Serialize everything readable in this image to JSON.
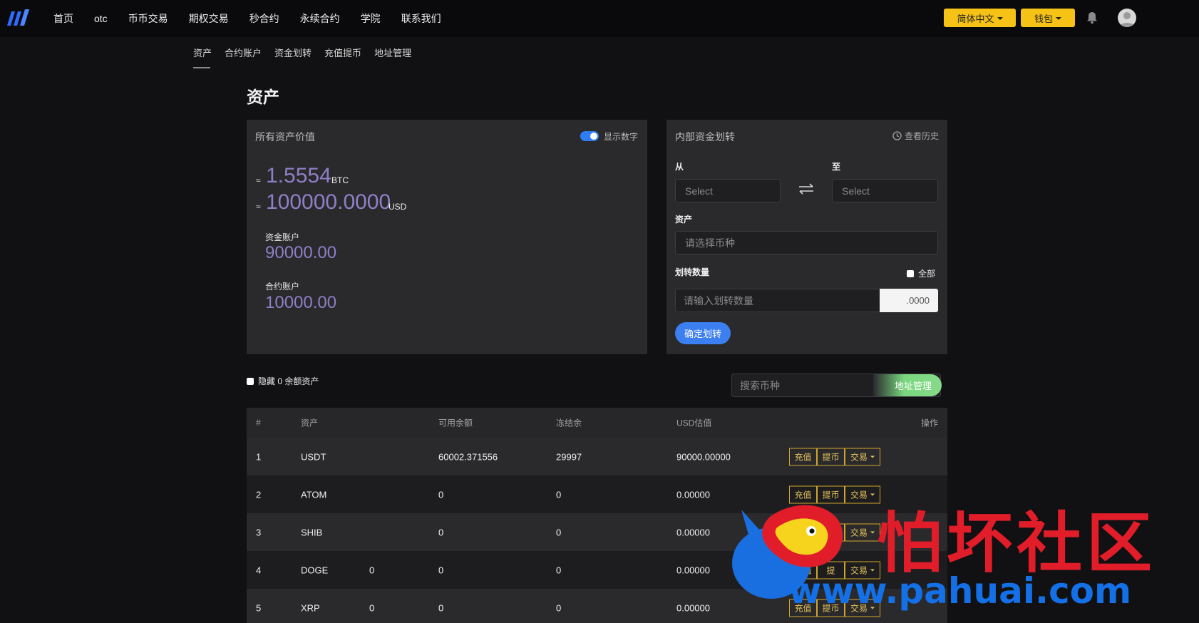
{
  "nav": {
    "items": [
      "首页",
      "otc",
      "币币交易",
      "期权交易",
      "秒合约",
      "永续合约",
      "学院",
      "联系我们"
    ],
    "language": "简体中文",
    "wallet": "钱包"
  },
  "subtabs": [
    "资产",
    "合约账户",
    "资金划转",
    "充值提币",
    "地址管理"
  ],
  "page_title": "资产",
  "assets_card": {
    "title": "所有资产价值",
    "toggle_label": "显示数字",
    "approx": "≈",
    "btc_value": "1.5554",
    "btc_unit": "BTC",
    "usd_value": "100000.0000",
    "usd_unit": "USD",
    "fund_label": "资金账户",
    "fund_value": "90000.00",
    "contract_label": "合约账户",
    "contract_value": "10000.00"
  },
  "transfer_card": {
    "title": "内部资金划转",
    "history": "查看历史",
    "from_label": "从",
    "to_label": "至",
    "from_placeholder": "Select",
    "to_placeholder": "Select",
    "asset_label": "资产",
    "asset_placeholder": "请选择币种",
    "amount_label": "划转数量",
    "all_label": "全部",
    "amount_placeholder": "请输入划转数量",
    "amount_suffix": ".0000",
    "confirm": "确定划转"
  },
  "filter": {
    "hide_zero": "隐藏 0 余额资产",
    "search_placeholder": "搜索币种",
    "address_mgmt": "地址管理"
  },
  "table": {
    "headers": [
      "#",
      "资产",
      "可用余额",
      "冻结余",
      "USD估值",
      "操作"
    ],
    "rows": [
      {
        "idx": "1",
        "asset": "USDT",
        "col3": "",
        "available": "60002.371556",
        "frozen": "29997",
        "usd": "90000.00000"
      },
      {
        "idx": "2",
        "asset": "ATOM",
        "col3": "",
        "available": "0",
        "frozen": "0",
        "usd": "0.00000"
      },
      {
        "idx": "3",
        "asset": "SHIB",
        "col3": "",
        "available": "0",
        "frozen": "0",
        "usd": "0.00000"
      },
      {
        "idx": "4",
        "asset": "DOGE",
        "col3": "0",
        "available": "0",
        "frozen": "0",
        "usd": "0.00000"
      },
      {
        "idx": "5",
        "asset": "XRP",
        "col3": "0",
        "available": "0",
        "frozen": "0",
        "usd": "0.00000"
      }
    ],
    "actions": {
      "deposit": "充值",
      "withdraw": "提币",
      "withdraw_short": "提",
      "trade": "交易"
    }
  },
  "watermark": {
    "text": "怕坏社区",
    "url": "www.pahuai.com"
  },
  "colors": {
    "accent_yellow": "#f5c215",
    "value_purple": "#8f7fc6",
    "primary_blue": "#3c7ff0",
    "green": "#86db8a"
  }
}
